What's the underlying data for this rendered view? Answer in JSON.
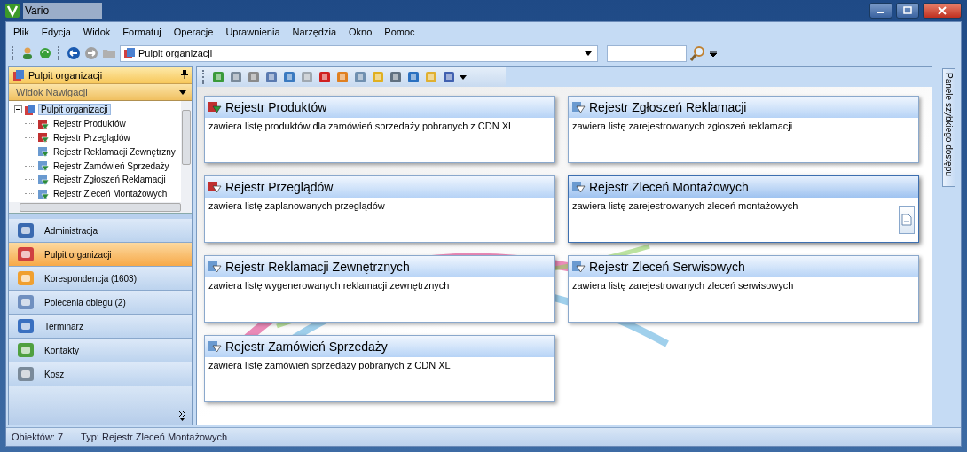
{
  "window": {
    "title": "Vario"
  },
  "menu": [
    "Plik",
    "Edycja",
    "Widok",
    "Formatuj",
    "Operacje",
    "Uprawnienia",
    "Narzędzia",
    "Okno",
    "Pomoc"
  ],
  "address_bar": {
    "value": "Pulpit organizacji"
  },
  "left_panel": {
    "header": "Pulpit organizacji",
    "view_selector": "Widok Nawigacji",
    "tree": [
      {
        "label": "Pulpit organizacji",
        "selected": true,
        "expanded": true,
        "children": [
          {
            "label": "Rejestr Produktów",
            "selected": false
          },
          {
            "label": "Rejestr Przeglądów",
            "selected": false
          },
          {
            "label": "Rejestr Reklamacji Zewnętrzny",
            "selected": false
          },
          {
            "label": "Rejestr Zamówień Sprzedaży",
            "selected": false
          },
          {
            "label": "Rejestr Zgłoszeń Reklamacji",
            "selected": false
          },
          {
            "label": "Rejestr Zleceń Montażowych",
            "selected": false
          }
        ]
      }
    ]
  },
  "nav_items": [
    {
      "label": "Administracja",
      "selected": false
    },
    {
      "label": "Pulpit organizacji",
      "selected": true
    },
    {
      "label": "Korespondencja (1603)",
      "selected": false
    },
    {
      "label": "Polecenia obiegu (2)",
      "selected": false
    },
    {
      "label": "Terminarz",
      "selected": false
    },
    {
      "label": "Kontakty",
      "selected": false
    },
    {
      "label": "Kosz",
      "selected": false
    }
  ],
  "cards": [
    {
      "title": "Rejestr Produktów",
      "description": "zawiera listę produktów dla zamówień sprzedaży pobranych z CDN XL",
      "selected": false
    },
    {
      "title": "Rejestr Zgłoszeń Reklamacji",
      "description": "zawiera listę zarejestrowanych zgłoszeń reklamacji",
      "selected": false
    },
    {
      "title": "Rejestr Przeglądów",
      "description": "zawiera listę zaplanowanych przeglądów",
      "selected": false
    },
    {
      "title": "Rejestr Zleceń Montażowych",
      "description": "zawiera listę zarejestrowanych zleceń montażowych",
      "selected": true
    },
    {
      "title": "Rejestr Reklamacji Zewnętrznych",
      "description": "zawiera listę wygenerowanych reklamacji zewnętrznych",
      "selected": false
    },
    {
      "title": "Rejestr Zleceń Serwisowych",
      "description": "zawiera listę zarejestrowanych zleceń serwisowych",
      "selected": false
    },
    {
      "title": "Rejestr Zamówień Sprzedaży",
      "description": "zawiera listę zamówień sprzedaży pobranych z CDN XL",
      "selected": false
    }
  ],
  "side_tab": {
    "label": "Panele szybkiego dostępu"
  },
  "status_bar": {
    "objects": "Obiektów: 7",
    "type": "Typ: Rejestr Zleceń Montażowych"
  }
}
